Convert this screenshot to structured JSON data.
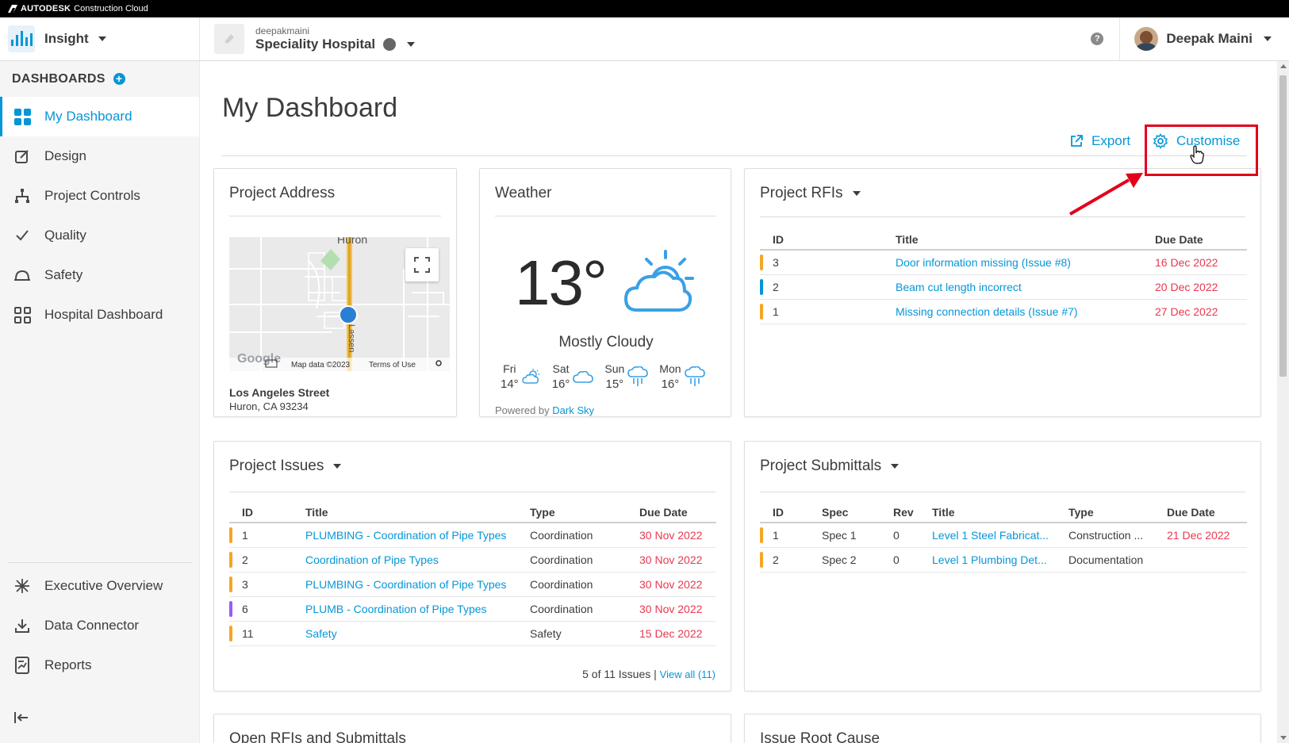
{
  "brand": {
    "company": "AUTODESK",
    "product": "Construction Cloud"
  },
  "header": {
    "app_name": "Insight",
    "account": "deepakmaini",
    "project": "Speciality Hospital",
    "help": "?",
    "user": "Deepak Maini"
  },
  "sidebar": {
    "section_title": "DASHBOARDS",
    "items": [
      {
        "label": "My Dashboard",
        "icon": "dashboard-grid-icon",
        "active": true
      },
      {
        "label": "Design",
        "icon": "pencil-square-icon"
      },
      {
        "label": "Project Controls",
        "icon": "hierarchy-icon"
      },
      {
        "label": "Quality",
        "icon": "checkmark-icon"
      },
      {
        "label": "Safety",
        "icon": "hardhat-icon"
      },
      {
        "label": "Hospital Dashboard",
        "icon": "grid-outline-icon"
      }
    ],
    "bottom_items": [
      {
        "label": "Executive Overview",
        "icon": "network-icon"
      },
      {
        "label": "Data Connector",
        "icon": "download-icon"
      },
      {
        "label": "Reports",
        "icon": "report-icon"
      }
    ]
  },
  "main": {
    "title": "My Dashboard",
    "export_label": "Export",
    "customise_label": "Customise"
  },
  "address_card": {
    "title": "Project Address",
    "map_city": "Huron",
    "map_street": "Lassen",
    "map_credit": "Map data ©2023",
    "map_terms": "Terms of Use",
    "map_logo": "Google",
    "street": "Los Angeles Street",
    "city": "Huron, CA 93234"
  },
  "weather_card": {
    "title": "Weather",
    "temperature": "13°",
    "condition": "Mostly Cloudy",
    "forecast": [
      {
        "day": "Fri",
        "temp": "14°",
        "icon": "partly-cloudy-icon"
      },
      {
        "day": "Sat",
        "temp": "16°",
        "icon": "cloud-icon"
      },
      {
        "day": "Sun",
        "temp": "15°",
        "icon": "rain-icon"
      },
      {
        "day": "Mon",
        "temp": "16°",
        "icon": "rain-icon"
      }
    ],
    "powered_prefix": "Powered by",
    "powered_link": "Dark Sky"
  },
  "rfi_card": {
    "title": "Project RFIs",
    "columns": [
      "ID",
      "Title",
      "Due Date"
    ],
    "rows": [
      {
        "id": "3",
        "title": "Door information missing (Issue #8)",
        "due": "16 Dec 2022",
        "color": "#f5a623"
      },
      {
        "id": "2",
        "title": "Beam cut length incorrect",
        "due": "20 Dec 2022",
        "color": "#0696d7"
      },
      {
        "id": "1",
        "title": "Missing connection details (Issue #7)",
        "due": "27 Dec 2022",
        "color": "#f5a623"
      }
    ]
  },
  "issues_card": {
    "title": "Project Issues",
    "columns": [
      "ID",
      "Title",
      "Type",
      "Due Date"
    ],
    "rows": [
      {
        "id": "1",
        "title": "PLUMBING - Coordination of Pipe Types",
        "type": "Coordination",
        "due": "30 Nov 2022",
        "color": "#f5a623"
      },
      {
        "id": "2",
        "title": "Coordination of Pipe Types",
        "type": "Coordination",
        "due": "30 Nov 2022",
        "color": "#f5a623"
      },
      {
        "id": "3",
        "title": "PLUMBING - Coordination of Pipe Types",
        "type": "Coordination",
        "due": "30 Nov 2022",
        "color": "#f5a623"
      },
      {
        "id": "6",
        "title": "PLUMB - Coordination of Pipe Types",
        "type": "Coordination",
        "due": "30 Nov 2022",
        "color": "#9b59f5"
      },
      {
        "id": "11",
        "title": "Safety",
        "type": "Safety",
        "due": "15 Dec 2022",
        "color": "#f5a623"
      }
    ],
    "count_text": "5 of 11 Issues",
    "view_all": "View all (11)"
  },
  "submittals_card": {
    "title": "Project Submittals",
    "columns": [
      "ID",
      "Spec",
      "Rev",
      "Title",
      "Type",
      "Due Date"
    ],
    "rows": [
      {
        "id": "1",
        "spec": "Spec 1",
        "rev": "0",
        "title": "Level 1 Steel Fabricat...",
        "type": "Construction ...",
        "due": "21 Dec 2022",
        "color": "#f5a623"
      },
      {
        "id": "2",
        "spec": "Spec 2",
        "rev": "0",
        "title": "Level 1 Plumbing Det...",
        "type": "Documentation",
        "due": "",
        "color": "#f5a623"
      }
    ]
  },
  "open_card": {
    "title": "Open RFIs and Submittals"
  },
  "root_card": {
    "title": "Issue Root Cause"
  },
  "colors": {
    "accent": "#0696d7",
    "overdue": "#e8384f",
    "highlight": "#e3001b"
  }
}
